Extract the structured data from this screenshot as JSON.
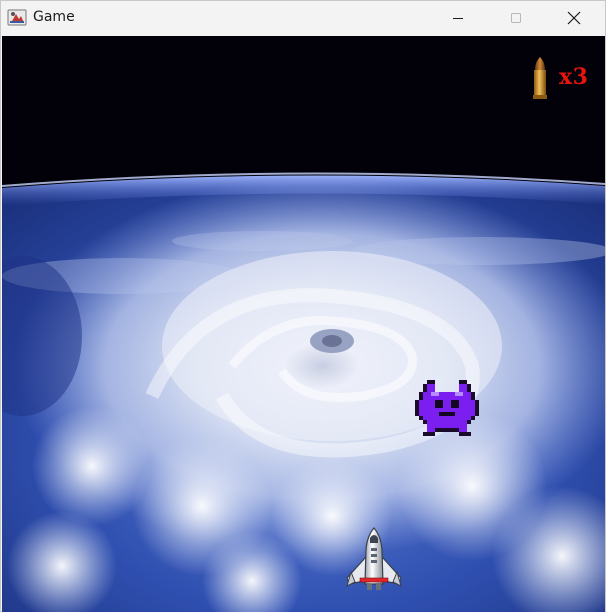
{
  "window": {
    "title": "Game",
    "minimize_icon": "minimize-icon",
    "maximize_icon": "maximize-icon",
    "close_icon": "close-icon"
  },
  "hud": {
    "ammo_icon": "bullet-icon",
    "ammo_count": "x3"
  },
  "scene": {
    "background": "earth-from-space-hurricane",
    "enemy": "purple-pixel-alien",
    "player": "white-space-shuttle"
  },
  "colors": {
    "ammo_text": "#e8150f",
    "enemy": "#7a1ff0",
    "sky": "#020008",
    "ocean": "#2f4fb0"
  }
}
